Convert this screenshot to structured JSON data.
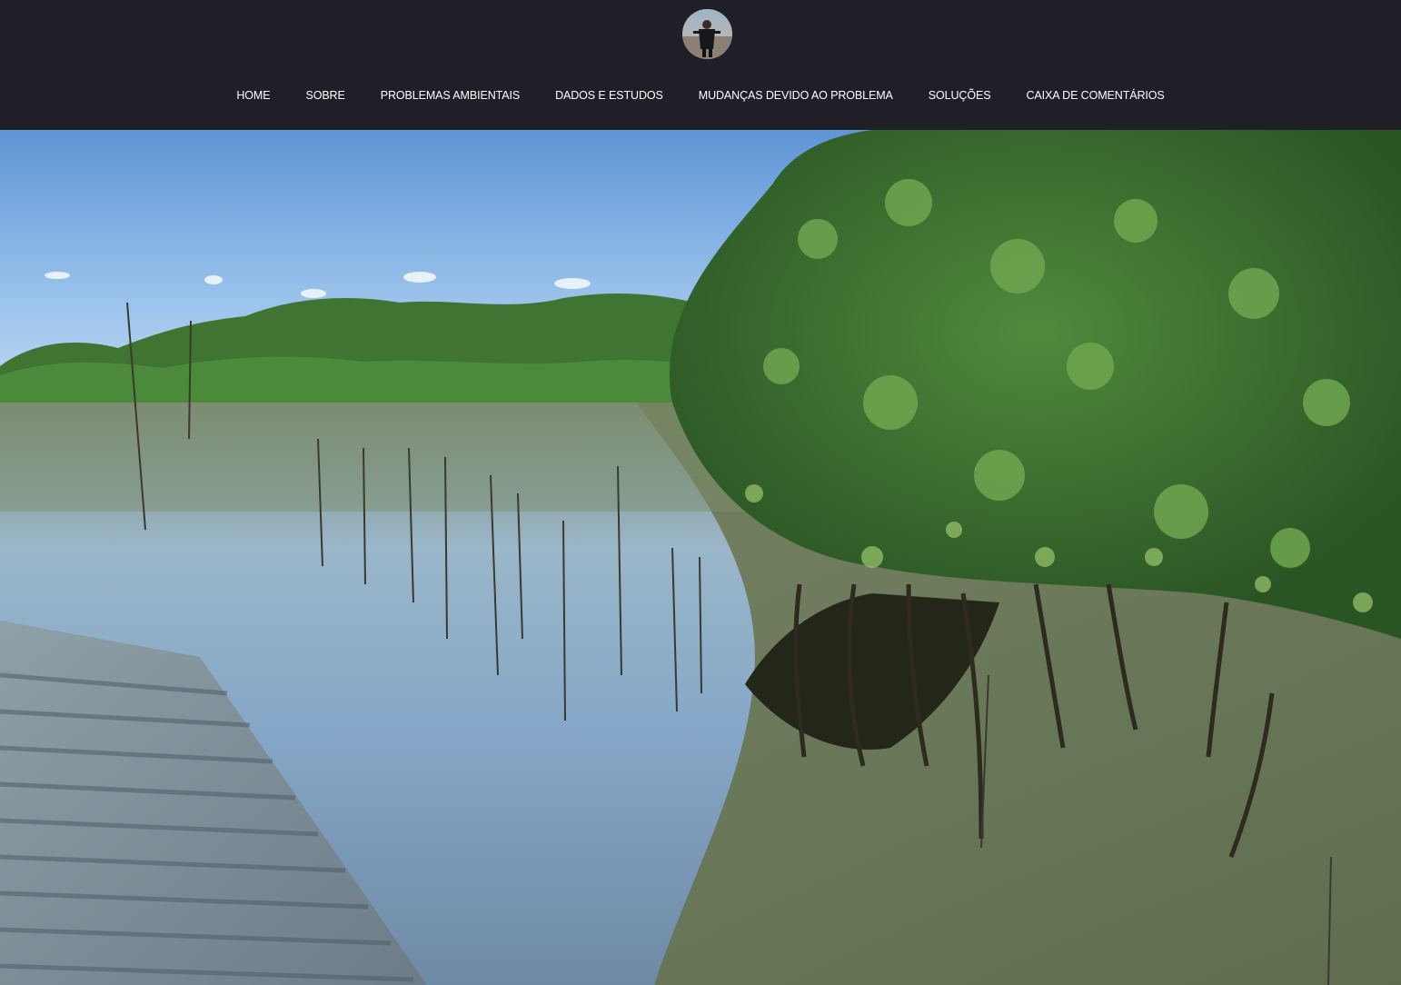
{
  "header": {
    "avatar_icon": "profile-photo-icon",
    "nav": [
      {
        "label": "HOME"
      },
      {
        "label": "SOBRE"
      },
      {
        "label": "PROBLEMAS AMBIENTAIS"
      },
      {
        "label": "DADOS E ESTUDOS"
      },
      {
        "label": "MUDANÇAS DEVIDO AO PROBLEMA"
      },
      {
        "label": "SOLUÇÕES"
      },
      {
        "label": "CAIXA DE COMENTÁRIOS"
      }
    ]
  },
  "hero": {
    "image_icon": "mangrove-landscape-photo"
  },
  "colors": {
    "header_bg": "#201f27",
    "nav_text": "#ffffff"
  }
}
